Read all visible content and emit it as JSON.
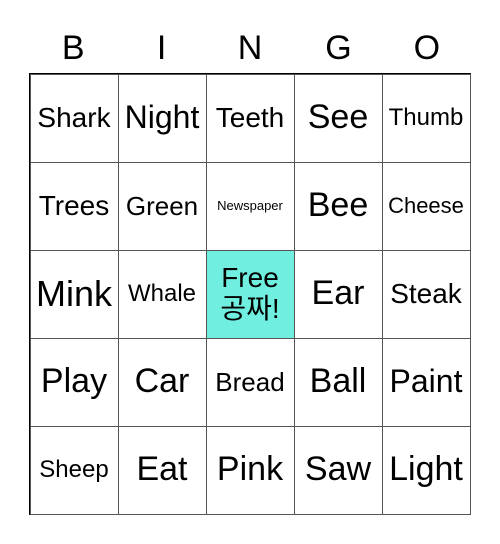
{
  "header": [
    "B",
    "I",
    "N",
    "G",
    "O"
  ],
  "free_color": "#70eee0",
  "cells": [
    [
      "Shark",
      "Night",
      "Teeth",
      "See",
      "Thumb"
    ],
    [
      "Trees",
      "Green",
      "Newspaper",
      "Bee",
      "Cheese"
    ],
    [
      "Mink",
      "Whale",
      "Free 공짜!",
      "Ear",
      "Steak"
    ],
    [
      "Play",
      "Car",
      "Bread",
      "Ball",
      "Paint"
    ],
    [
      "Sheep",
      "Eat",
      "Pink",
      "Saw",
      "Light"
    ]
  ]
}
